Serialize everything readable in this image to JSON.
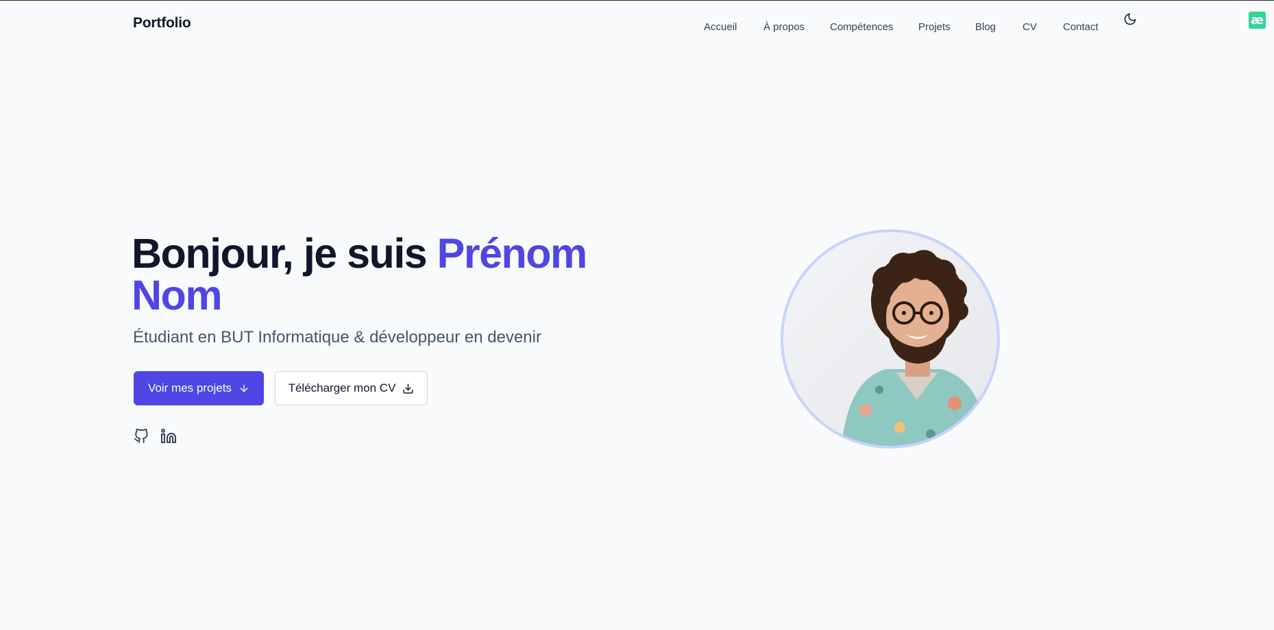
{
  "header": {
    "brand": "Portfolio",
    "nav": [
      "Accueil",
      "À propos",
      "Compétences",
      "Projets",
      "Blog",
      "CV",
      "Contact"
    ],
    "theme_toggle_icon": "moon-icon",
    "extension_icon": "æ"
  },
  "hero": {
    "greeting": "Bonjour, je suis ",
    "name": "Prénom Nom",
    "subtitle": "Étudiant en BUT Informatique & développeur en devenir",
    "primary_button": "Voir mes projets",
    "primary_button_icon": "arrow-down-icon",
    "secondary_button": "Télécharger mon CV",
    "secondary_button_icon": "download-icon",
    "socials": [
      "github-icon",
      "linkedin-icon"
    ]
  },
  "colors": {
    "accent": "#4f46e5",
    "background": "#f8fafc",
    "text": "#0f172a",
    "muted": "#475569",
    "avatar_ring": "#c7d2fe"
  }
}
